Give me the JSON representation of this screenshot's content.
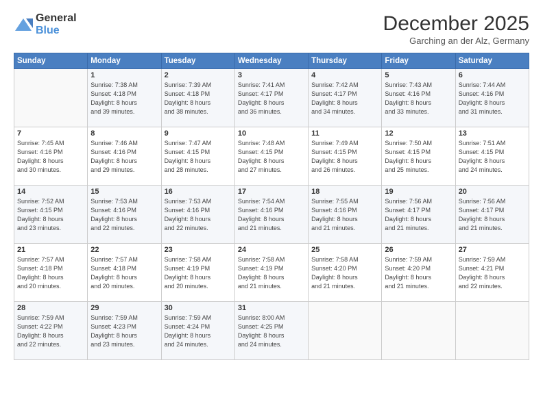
{
  "logo": {
    "general": "General",
    "blue": "Blue"
  },
  "header": {
    "month": "December 2025",
    "location": "Garching an der Alz, Germany"
  },
  "days_header": [
    "Sunday",
    "Monday",
    "Tuesday",
    "Wednesday",
    "Thursday",
    "Friday",
    "Saturday"
  ],
  "weeks": [
    [
      {
        "day": "",
        "info": ""
      },
      {
        "day": "1",
        "info": "Sunrise: 7:38 AM\nSunset: 4:18 PM\nDaylight: 8 hours\nand 39 minutes."
      },
      {
        "day": "2",
        "info": "Sunrise: 7:39 AM\nSunset: 4:18 PM\nDaylight: 8 hours\nand 38 minutes."
      },
      {
        "day": "3",
        "info": "Sunrise: 7:41 AM\nSunset: 4:17 PM\nDaylight: 8 hours\nand 36 minutes."
      },
      {
        "day": "4",
        "info": "Sunrise: 7:42 AM\nSunset: 4:17 PM\nDaylight: 8 hours\nand 34 minutes."
      },
      {
        "day": "5",
        "info": "Sunrise: 7:43 AM\nSunset: 4:16 PM\nDaylight: 8 hours\nand 33 minutes."
      },
      {
        "day": "6",
        "info": "Sunrise: 7:44 AM\nSunset: 4:16 PM\nDaylight: 8 hours\nand 31 minutes."
      }
    ],
    [
      {
        "day": "7",
        "info": "Sunrise: 7:45 AM\nSunset: 4:16 PM\nDaylight: 8 hours\nand 30 minutes."
      },
      {
        "day": "8",
        "info": "Sunrise: 7:46 AM\nSunset: 4:16 PM\nDaylight: 8 hours\nand 29 minutes."
      },
      {
        "day": "9",
        "info": "Sunrise: 7:47 AM\nSunset: 4:15 PM\nDaylight: 8 hours\nand 28 minutes."
      },
      {
        "day": "10",
        "info": "Sunrise: 7:48 AM\nSunset: 4:15 PM\nDaylight: 8 hours\nand 27 minutes."
      },
      {
        "day": "11",
        "info": "Sunrise: 7:49 AM\nSunset: 4:15 PM\nDaylight: 8 hours\nand 26 minutes."
      },
      {
        "day": "12",
        "info": "Sunrise: 7:50 AM\nSunset: 4:15 PM\nDaylight: 8 hours\nand 25 minutes."
      },
      {
        "day": "13",
        "info": "Sunrise: 7:51 AM\nSunset: 4:15 PM\nDaylight: 8 hours\nand 24 minutes."
      }
    ],
    [
      {
        "day": "14",
        "info": "Sunrise: 7:52 AM\nSunset: 4:15 PM\nDaylight: 8 hours\nand 23 minutes."
      },
      {
        "day": "15",
        "info": "Sunrise: 7:53 AM\nSunset: 4:16 PM\nDaylight: 8 hours\nand 22 minutes."
      },
      {
        "day": "16",
        "info": "Sunrise: 7:53 AM\nSunset: 4:16 PM\nDaylight: 8 hours\nand 22 minutes."
      },
      {
        "day": "17",
        "info": "Sunrise: 7:54 AM\nSunset: 4:16 PM\nDaylight: 8 hours\nand 21 minutes."
      },
      {
        "day": "18",
        "info": "Sunrise: 7:55 AM\nSunset: 4:16 PM\nDaylight: 8 hours\nand 21 minutes."
      },
      {
        "day": "19",
        "info": "Sunrise: 7:56 AM\nSunset: 4:17 PM\nDaylight: 8 hours\nand 21 minutes."
      },
      {
        "day": "20",
        "info": "Sunrise: 7:56 AM\nSunset: 4:17 PM\nDaylight: 8 hours\nand 21 minutes."
      }
    ],
    [
      {
        "day": "21",
        "info": "Sunrise: 7:57 AM\nSunset: 4:18 PM\nDaylight: 8 hours\nand 20 minutes."
      },
      {
        "day": "22",
        "info": "Sunrise: 7:57 AM\nSunset: 4:18 PM\nDaylight: 8 hours\nand 20 minutes."
      },
      {
        "day": "23",
        "info": "Sunrise: 7:58 AM\nSunset: 4:19 PM\nDaylight: 8 hours\nand 20 minutes."
      },
      {
        "day": "24",
        "info": "Sunrise: 7:58 AM\nSunset: 4:19 PM\nDaylight: 8 hours\nand 21 minutes."
      },
      {
        "day": "25",
        "info": "Sunrise: 7:58 AM\nSunset: 4:20 PM\nDaylight: 8 hours\nand 21 minutes."
      },
      {
        "day": "26",
        "info": "Sunrise: 7:59 AM\nSunset: 4:20 PM\nDaylight: 8 hours\nand 21 minutes."
      },
      {
        "day": "27",
        "info": "Sunrise: 7:59 AM\nSunset: 4:21 PM\nDaylight: 8 hours\nand 22 minutes."
      }
    ],
    [
      {
        "day": "28",
        "info": "Sunrise: 7:59 AM\nSunset: 4:22 PM\nDaylight: 8 hours\nand 22 minutes."
      },
      {
        "day": "29",
        "info": "Sunrise: 7:59 AM\nSunset: 4:23 PM\nDaylight: 8 hours\nand 23 minutes."
      },
      {
        "day": "30",
        "info": "Sunrise: 7:59 AM\nSunset: 4:24 PM\nDaylight: 8 hours\nand 24 minutes."
      },
      {
        "day": "31",
        "info": "Sunrise: 8:00 AM\nSunset: 4:25 PM\nDaylight: 8 hours\nand 24 minutes."
      },
      {
        "day": "",
        "info": ""
      },
      {
        "day": "",
        "info": ""
      },
      {
        "day": "",
        "info": ""
      }
    ]
  ]
}
